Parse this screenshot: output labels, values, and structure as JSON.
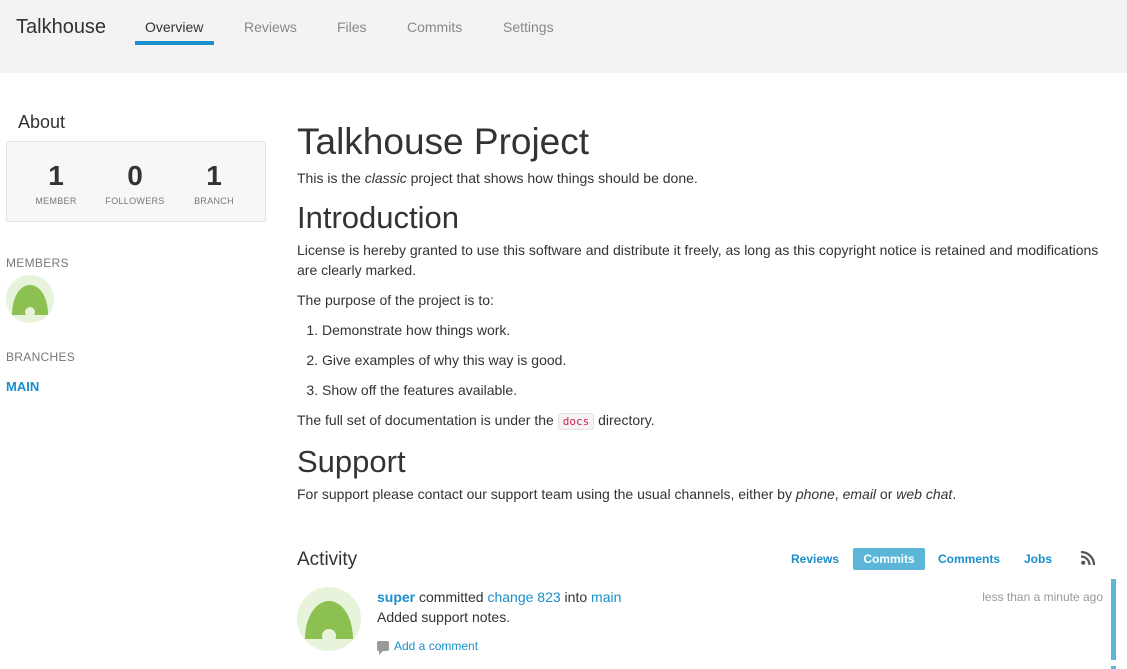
{
  "brand": "Talkhouse",
  "nav": {
    "tabs": [
      "Overview",
      "Reviews",
      "Files",
      "Commits",
      "Settings"
    ],
    "active": "Overview"
  },
  "sidebar": {
    "about_title": "About",
    "stats": [
      {
        "num": "1",
        "label": "MEMBER"
      },
      {
        "num": "0",
        "label": "FOLLOWERS"
      },
      {
        "num": "1",
        "label": "BRANCH"
      }
    ],
    "members_heading": "MEMBERS",
    "branches_heading": "BRANCHES",
    "branch": "MAIN"
  },
  "readme": {
    "title": "Talkhouse Project",
    "intro_before": "This is the ",
    "intro_em": "classic",
    "intro_after": " project that shows how things should be done.",
    "h_intro": "Introduction",
    "license": "License is hereby granted to use this software and distribute it freely, as long as this copyright notice is retained and modifications are clearly marked.",
    "purpose": "The purpose of the project is to:",
    "list": [
      "Demonstrate how things work.",
      "Give examples of why this way is good.",
      "Show off the features available."
    ],
    "docs_before": "The full set of documentation is under the ",
    "docs_code": "docs",
    "docs_after": " directory.",
    "h_support": "Support",
    "support_before": "For support please contact our support team using the usual channels, either by ",
    "support_phone": "phone",
    "support_comma": ", ",
    "support_email": "email",
    "support_or": " or ",
    "support_webchat": "web chat",
    "support_end": "."
  },
  "activity": {
    "title": "Activity",
    "tabs": [
      "Reviews",
      "Commits",
      "Comments",
      "Jobs"
    ],
    "active_tab": "Commits",
    "rss_icon": "rss-icon",
    "entry": {
      "user": "super",
      "verb": " committed ",
      "change": "change 823",
      "into": " into ",
      "branch": "main",
      "message": "Added support notes.",
      "time": "less than a minute ago",
      "add_comment": "Add a comment"
    }
  },
  "colors": {
    "accent": "#1a8fcb",
    "active_tab_bg": "#5bb6d8",
    "avatar_green": "#8cc152"
  }
}
